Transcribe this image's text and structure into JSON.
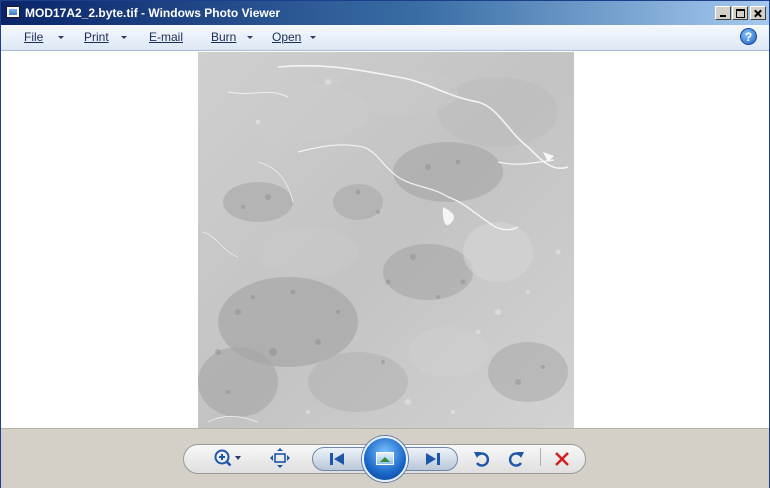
{
  "window": {
    "title": "MOD17A2_2.byte.tif - Windows Photo Viewer"
  },
  "menu": {
    "file": "File",
    "print": "Print",
    "email": "E-mail",
    "burn": "Burn",
    "open": "Open",
    "help_glyph": "?"
  },
  "icons": {
    "app": "photo-viewer-icon",
    "help": "help-icon",
    "zoom": "zoom-icon",
    "actual_size": "actual-size-icon",
    "previous": "previous-icon",
    "slideshow": "slideshow-icon",
    "next": "next-icon",
    "rotate_ccw": "rotate-counterclockwise-icon",
    "rotate_cw": "rotate-clockwise-icon",
    "delete": "delete-icon"
  },
  "colors": {
    "accent": "#1a66c8",
    "delete": "#d21f1f",
    "toolbar_icon": "#1e56a8"
  }
}
